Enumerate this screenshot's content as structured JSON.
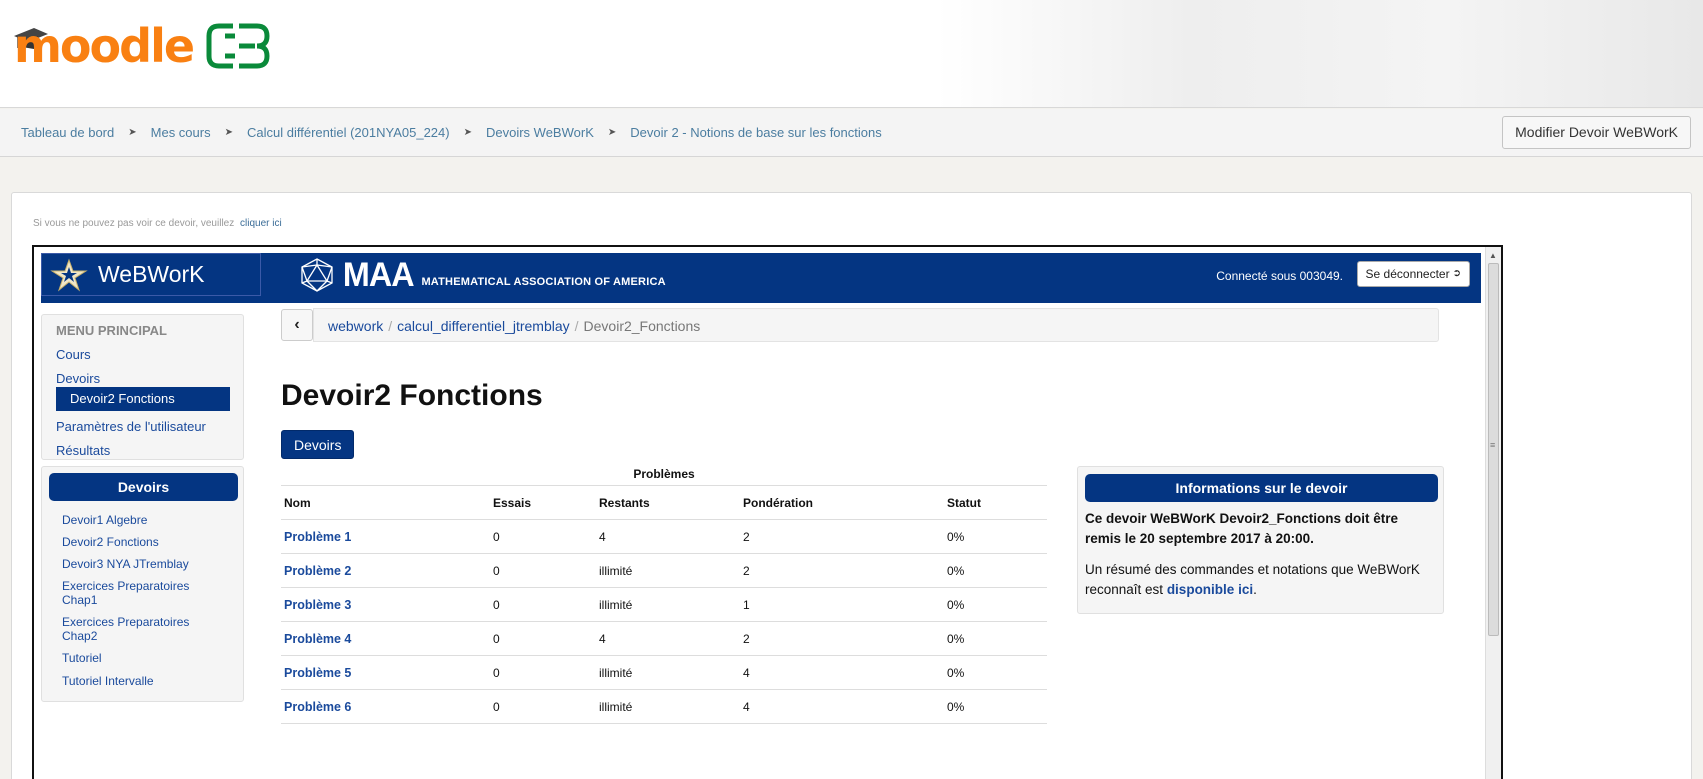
{
  "moodle": {
    "logo_text": "moodle",
    "breadcrumbs": [
      "Tableau de bord",
      "Mes cours",
      "Calcul différentiel (201NYA05_224)",
      "Devoirs WeBWorK",
      "Devoir 2 - Notions de base sur les fonctions"
    ],
    "edit_button": "Modifier Devoir WeBWorK",
    "notice_text": "Si vous ne pouvez pas voir ce devoir, veuillez",
    "notice_link": "cliquer ici"
  },
  "webwork": {
    "brand": "WeBWorK",
    "maa_big": "MAA",
    "maa_small": "MATHEMATICAL ASSOCIATION OF AMERICA",
    "logged_in": "Connecté sous 003049.",
    "logout": "Se déconnecter",
    "menu": {
      "title": "MENU PRINCIPAL",
      "items": [
        "Cours",
        "Devoirs",
        "Devoir2 Fonctions",
        "Paramètres de l'utilisateur",
        "Résultats"
      ]
    },
    "homework": {
      "title": "Devoirs",
      "items": [
        "Devoir1 Algebre",
        "Devoir2 Fonctions",
        "Devoir3 NYA JTremblay",
        "Exercices Preparatoires Chap1",
        "Exercices Preparatoires Chap2",
        "Tutoriel",
        "Tutoriel Intervalle"
      ]
    },
    "path": [
      "webwork",
      "calcul_differentiel_jtremblay",
      "Devoir2_Fonctions"
    ],
    "set_title": "Devoir2 Fonctions",
    "devoirs_button": "Devoirs",
    "problems": {
      "caption": "Problèmes",
      "headers": [
        "Nom",
        "Essais",
        "Restants",
        "Pondération",
        "Statut"
      ],
      "rows": [
        [
          "Problème 1",
          "0",
          "4",
          "2",
          "0%"
        ],
        [
          "Problème 2",
          "0",
          "illimité",
          "2",
          "0%"
        ],
        [
          "Problème 3",
          "0",
          "illimité",
          "1",
          "0%"
        ],
        [
          "Problème 4",
          "0",
          "4",
          "2",
          "0%"
        ],
        [
          "Problème 5",
          "0",
          "illimité",
          "4",
          "0%"
        ],
        [
          "Problème 6",
          "0",
          "illimité",
          "4",
          "0%"
        ]
      ]
    },
    "info": {
      "title": "Informations sur le devoir",
      "due": "Ce devoir WeBWorK Devoir2_Fonctions doit être remis le 20 septembre 2017 à 20:00.",
      "summary_prefix": "Un résumé des commandes et notations que WeBWorK reconnaît est",
      "summary_link": "disponible ici",
      "summary_suffix": "."
    }
  },
  "colors": {
    "moodle_orange": "#f98012",
    "webwork_blue": "#043582",
    "link_blue": "#1a4a9c",
    "breadcrumb_link": "#4b7da0"
  }
}
